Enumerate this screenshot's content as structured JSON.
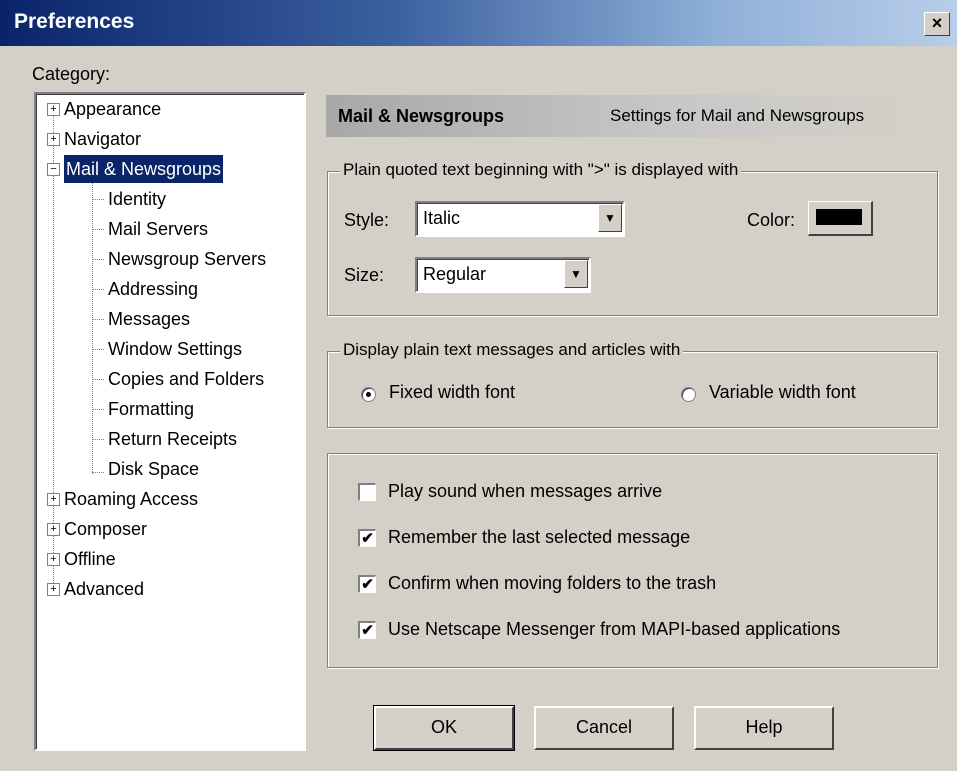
{
  "window": {
    "title": "Preferences",
    "close_glyph": "×"
  },
  "category_label": "Category:",
  "tree": {
    "items": [
      {
        "label": "Appearance",
        "expander": "+"
      },
      {
        "label": "Navigator",
        "expander": "+"
      },
      {
        "label": "Mail & Newsgroups",
        "expander": "−",
        "selected": true
      },
      {
        "label": "Identity"
      },
      {
        "label": "Mail Servers"
      },
      {
        "label": "Newsgroup Servers"
      },
      {
        "label": "Addressing"
      },
      {
        "label": "Messages"
      },
      {
        "label": "Window Settings"
      },
      {
        "label": "Copies and Folders"
      },
      {
        "label": "Formatting"
      },
      {
        "label": "Return Receipts"
      },
      {
        "label": "Disk Space"
      },
      {
        "label": "Roaming Access",
        "expander": "+"
      },
      {
        "label": "Composer",
        "expander": "+"
      },
      {
        "label": "Offline",
        "expander": "+"
      },
      {
        "label": "Advanced",
        "expander": "+"
      }
    ]
  },
  "header": {
    "title": "Mail & Newsgroups",
    "description": "Settings for Mail and Newsgroups"
  },
  "quoted_text": {
    "legend": "Plain quoted text beginning with \">\" is displayed with",
    "style_label": "Style:",
    "style_value": "Italic",
    "size_label": "Size:",
    "size_value": "Regular",
    "color_label": "Color:",
    "color_value": "#000000"
  },
  "plain_text": {
    "legend": "Display plain text messages and articles with",
    "fixed_label": "Fixed width font",
    "variable_label": "Variable width font",
    "selected": "fixed"
  },
  "options": [
    {
      "label": "Play sound when messages arrive",
      "checked": false
    },
    {
      "label": "Remember the last selected message",
      "checked": true
    },
    {
      "label": "Confirm when moving folders to the trash",
      "checked": true
    },
    {
      "label": "Use Netscape Messenger from MAPI-based applications",
      "checked": true
    }
  ],
  "buttons": {
    "ok": "OK",
    "cancel": "Cancel",
    "help": "Help"
  },
  "check_glyph": "✔",
  "dropdown_glyph": "▼"
}
